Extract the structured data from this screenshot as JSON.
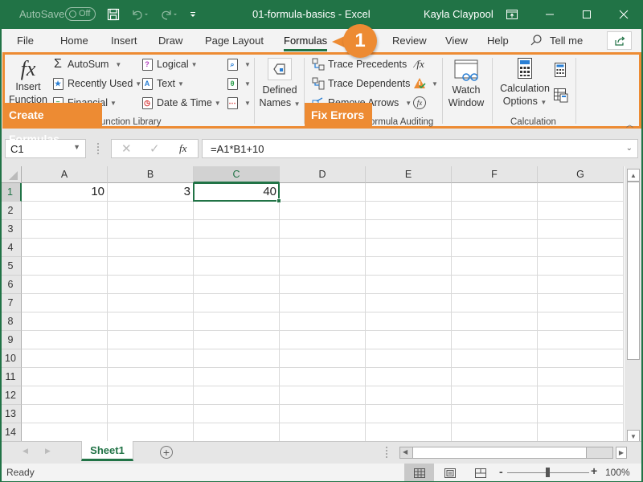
{
  "titlebar": {
    "autosave_label": "AutoSave",
    "autosave_state": "Off",
    "doc_title": "01-formula-basics  -  Excel",
    "user_name": "Kayla Claypool",
    "qat_icons": [
      "save-icon",
      "undo-icon",
      "redo-icon",
      "customize-qat-icon"
    ],
    "window_icons": [
      "ribbon-display-options-icon",
      "minimize-icon",
      "maximize-icon",
      "close-icon"
    ]
  },
  "tabs": [
    {
      "label": "File"
    },
    {
      "label": "Home"
    },
    {
      "label": "Insert"
    },
    {
      "label": "Draw"
    },
    {
      "label": "Page Layout"
    },
    {
      "label": "Formulas",
      "active": true
    },
    {
      "label": "Review"
    },
    {
      "label": "View"
    },
    {
      "label": "Help"
    },
    {
      "label": "Tell me"
    }
  ],
  "callout": {
    "number": "1",
    "color": "#ed8b33"
  },
  "ribbon": {
    "function_library": {
      "group_label": "Function Library",
      "insert_function": {
        "line1": "Insert",
        "line2": "Function",
        "icon": "fx-icon"
      },
      "autosum": "AutoSum",
      "recently_used": "Recently Used",
      "financial": "Financial",
      "logical": "Logical",
      "text": "Text",
      "date_time": "Date & Time",
      "lookup_icon": "lookup-reference-icon",
      "math_icon": "math-trig-icon",
      "more_icon": "more-functions-icon"
    },
    "defined_names": {
      "line1": "Defined",
      "line2": "Names"
    },
    "formula_auditing": {
      "group_label": "Formula Auditing",
      "trace_precedents": "Trace Precedents",
      "trace_dependents": "Trace Dependents",
      "remove_arrows": "Remove Arrows",
      "watch_window": {
        "line1": "Watch",
        "line2": "Window"
      }
    },
    "calculation": {
      "group_label": "Calculation",
      "options": {
        "line1": "Calculation",
        "line2": "Options"
      }
    },
    "overlay_labels": {
      "create_formulas": "Create Formulas",
      "fix_errors": "Fix Errors"
    }
  },
  "formula_bar": {
    "name_box": "C1",
    "formula": "=A1*B1+10",
    "fx_label": "fx"
  },
  "grid": {
    "columns": [
      "A",
      "B",
      "C",
      "D",
      "E",
      "F",
      "G"
    ],
    "selected_column": "C",
    "rows": [
      "1",
      "2",
      "3",
      "4",
      "5",
      "6",
      "7",
      "8",
      "9",
      "10",
      "11",
      "12",
      "13",
      "14"
    ],
    "selected_row": "1",
    "cells": {
      "A1": "10",
      "B1": "3",
      "C1": "40"
    },
    "active_cell": "C1"
  },
  "sheets": [
    {
      "name": "Sheet1",
      "active": true
    }
  ],
  "status": {
    "ready": "Ready",
    "zoom": "100%",
    "zoom_minus": "-",
    "zoom_plus": "+"
  },
  "colors": {
    "excel_green": "#217346",
    "highlight_orange": "#ed8b33"
  }
}
